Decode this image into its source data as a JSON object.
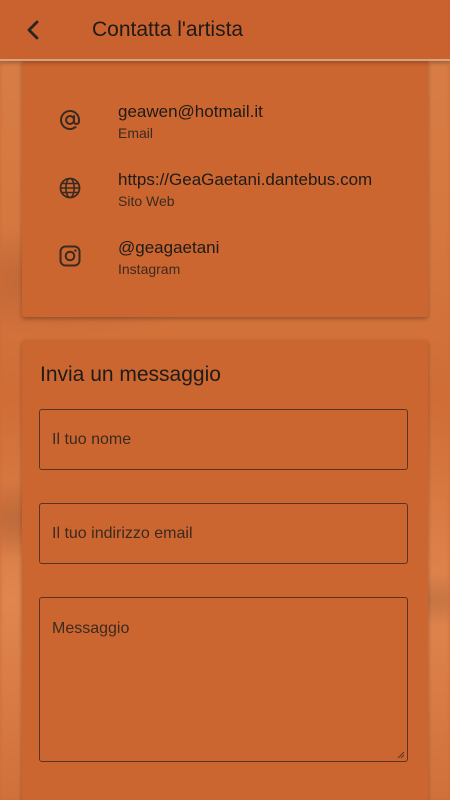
{
  "appbar": {
    "title": "Contatta l'artista",
    "back_icon": "chevron-left-icon"
  },
  "contacts": [
    {
      "icon": "at-sign-icon",
      "value": "geawen@hotmail.it",
      "label": "Email"
    },
    {
      "icon": "globe-icon",
      "value": "https://GeaGaetani.dantebus.com",
      "label": "Sito Web"
    },
    {
      "icon": "instagram-icon",
      "value": "@geagaetani",
      "label": "Instagram"
    }
  ],
  "form": {
    "title": "Invia un messaggio",
    "name_placeholder": "Il tuo nome",
    "email_placeholder": "Il tuo indirizzo email",
    "message_placeholder": "Messaggio"
  },
  "colors": {
    "accent": "#cc6630",
    "appbar": "#c9622e",
    "text": "#1f1b18"
  }
}
